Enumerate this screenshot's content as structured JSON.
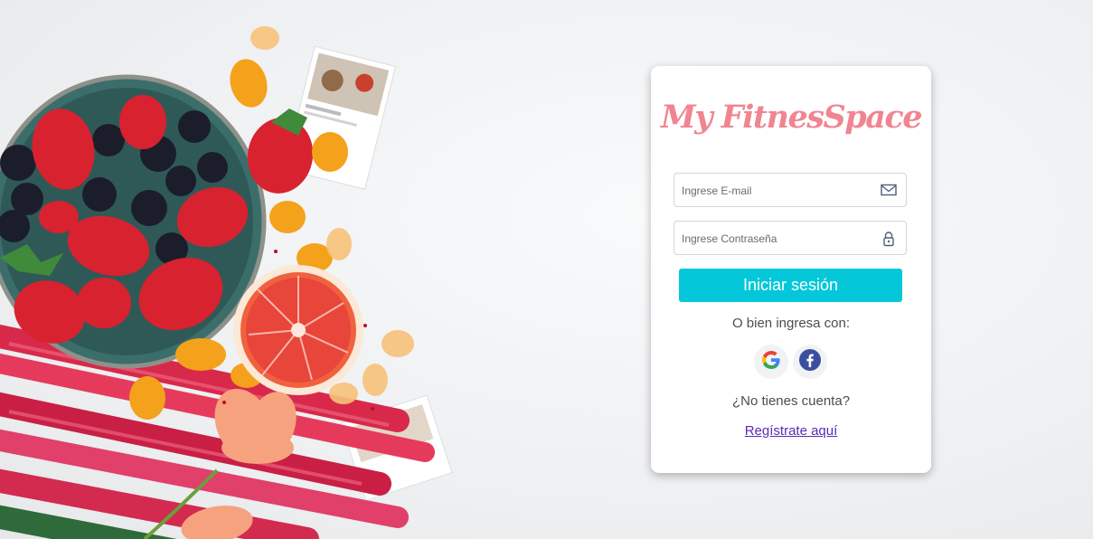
{
  "brand": {
    "title": "My FitnesSpace",
    "color": "#f08591"
  },
  "login_form": {
    "email_placeholder": "Ingrese E-mail",
    "email_icon": "envelope-icon",
    "password_placeholder": "Ingrese Contraseña",
    "password_icon": "lock-icon",
    "submit_label": "Iniciar sesión",
    "submit_color": "#04c8d9",
    "alt_login_text": "O bien ingresa con:",
    "social": [
      {
        "name": "Google",
        "icon": "google-icon"
      },
      {
        "name": "Facebook",
        "icon": "facebook-icon",
        "color": "#3b4fa0"
      }
    ],
    "no_account_text": "¿No tienes cuenta?",
    "register_link": "Regístrate aquí"
  }
}
